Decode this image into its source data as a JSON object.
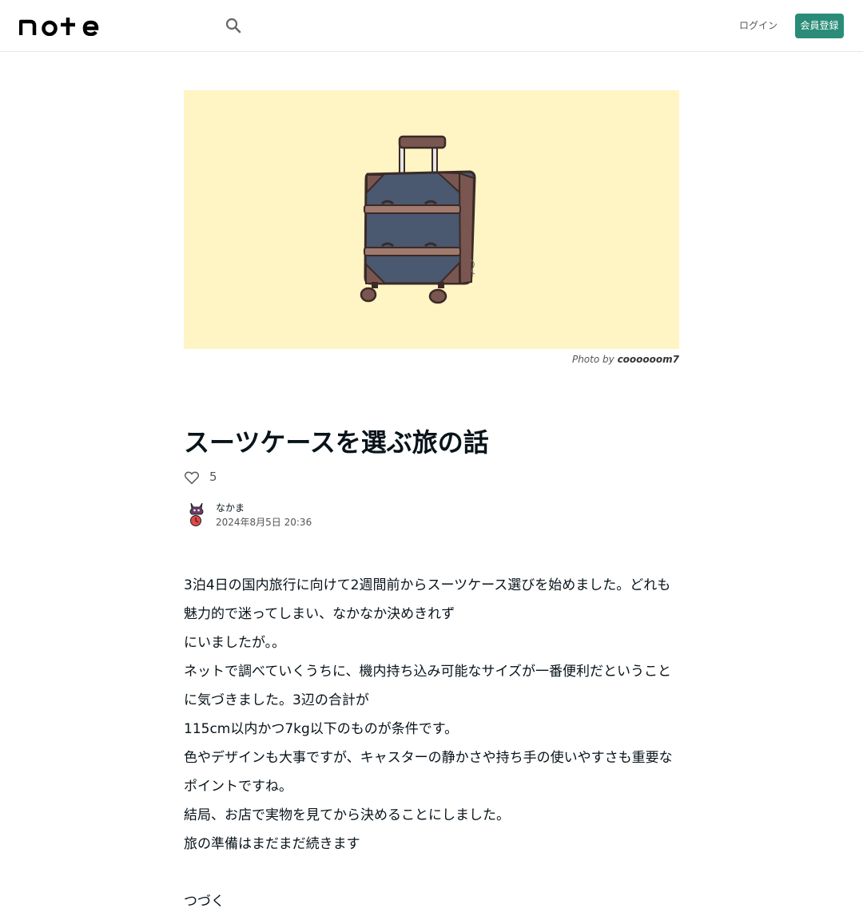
{
  "header": {
    "logo_text": "note",
    "search_icon": "search-icon",
    "login_label": "ログイン",
    "signup_label": "会員登録",
    "signup_color": "#2a8c78"
  },
  "hero": {
    "background_color": "#fff4c4",
    "image_subject": "suitcase illustration",
    "credit_prefix": "Photo by",
    "credit_user": "coooooom7"
  },
  "article": {
    "title": "スーツケースを選ぶ旅の話",
    "like_icon": "heart-outline-icon",
    "like_count": "5",
    "author_name": "なかま",
    "date": "2024年8月5日 20:36",
    "paragraphs": [
      "3泊4日の国内旅行に向けて2週間前からスーツケース選びを始めました。どれも魅力的で迷ってしまい、なかなか決めきれず",
      "にいましたが。。",
      "ネットで調べていくうちに、機内持ち込み可能なサイズが一番便利だということに気づきました。3辺の合計が",
      "115cm以内かつ7kg以下のものが条件です。",
      "色やデザインも大事ですが、キャスターの静かさや持ち手の使いやすさも重要なポイントですね。",
      "結局、お店で実物を見てから決めることにしました。",
      "旅の準備はまだまだ続きます",
      "",
      "つづく"
    ]
  }
}
